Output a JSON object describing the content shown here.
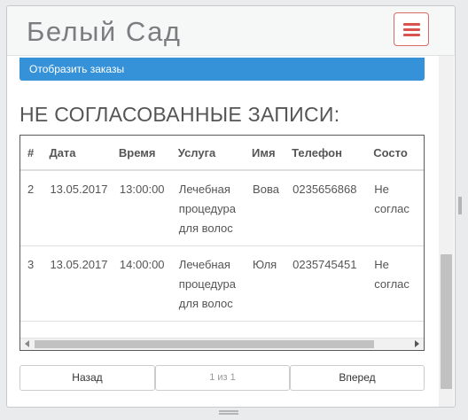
{
  "navbar": {
    "brand": "Белый Сад",
    "menu_icon": "hamburger-icon",
    "menu_color": "#d9534f"
  },
  "actions": {
    "show_orders_label": "Отобразить заказы"
  },
  "section": {
    "title": "НЕ СОГЛАСОВАННЫЕ ЗАПИСИ:"
  },
  "table": {
    "headers": [
      "#",
      "Дата",
      "Время",
      "Услуга",
      "Имя",
      "Телефон",
      "Состояние"
    ],
    "header_visible": [
      "#",
      "Дата",
      "Время",
      "Услуга",
      "Имя",
      "Телефон",
      "Состо"
    ],
    "rows": [
      {
        "num": "2",
        "date": "13.05.2017",
        "time": "13:00:00",
        "service": [
          "Лечебная",
          "процедура",
          "для волос"
        ],
        "name": "Вова",
        "phone": "0235656868",
        "status": [
          "Не",
          "соглас"
        ]
      },
      {
        "num": "3",
        "date": "13.05.2017",
        "time": "14:00:00",
        "service": [
          "Лечебная",
          "процедура",
          "для волос"
        ],
        "name": "Юля",
        "phone": "0235745451",
        "status": [
          "Не",
          "соглас"
        ]
      }
    ]
  },
  "pager": {
    "prev_label": "Назад",
    "page_indicator": "1 из 1",
    "next_label": "Вперед"
  },
  "colors": {
    "accent": "#3592d8",
    "text": "#555555"
  }
}
